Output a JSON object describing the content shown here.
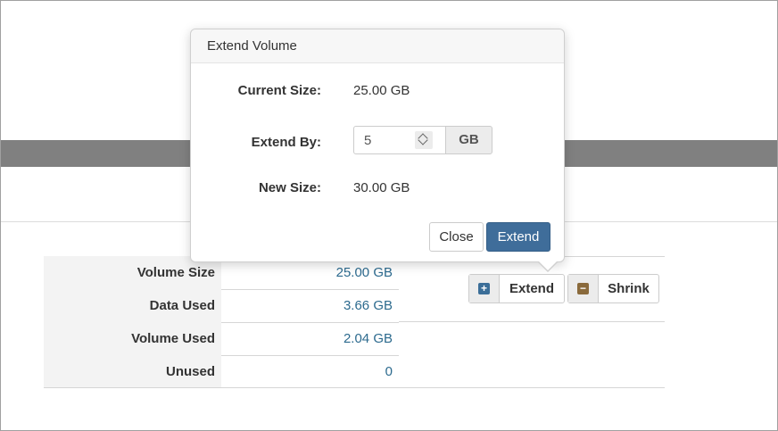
{
  "colors": {
    "link": "#2c6a8e",
    "primary": "#3f6d9a",
    "extend_icon": "#3b6e98",
    "shrink_icon": "#8a6a3c"
  },
  "stats": [
    {
      "label": "Volume Size",
      "value": "25.00 GB"
    },
    {
      "label": "Data Used",
      "value": "3.66 GB"
    },
    {
      "label": "Volume Used",
      "value": "2.04 GB"
    },
    {
      "label": "Unused",
      "value": "0"
    }
  ],
  "actions": {
    "extend": {
      "label": "Extend",
      "icon": "plus-icon",
      "symbol": "+"
    },
    "shrink": {
      "label": "Shrink",
      "icon": "minus-icon",
      "symbol": "−"
    }
  },
  "popover": {
    "title": "Extend Volume",
    "current_size_label": "Current Size:",
    "current_size_value": "25.00 GB",
    "extend_by_label": "Extend By:",
    "extend_by_value": "5",
    "extend_by_unit": "GB",
    "new_size_label": "New Size:",
    "new_size_value": "30.00 GB",
    "close_label": "Close",
    "extend_label": "Extend"
  }
}
